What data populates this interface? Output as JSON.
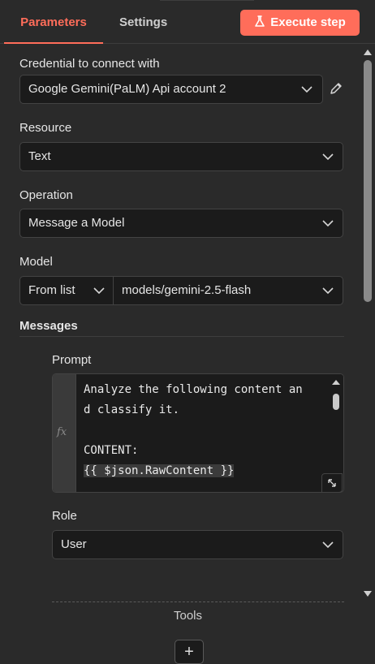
{
  "tabs": {
    "parameters": "Parameters",
    "settings": "Settings"
  },
  "execute_button": {
    "label": "Execute step",
    "color": "#ff6d5a"
  },
  "credential": {
    "label": "Credential to connect with",
    "value": "Google Gemini(PaLM) Api account 2"
  },
  "resource": {
    "label": "Resource",
    "value": "Text"
  },
  "operation": {
    "label": "Operation",
    "value": "Message a Model"
  },
  "model": {
    "label": "Model",
    "mode": "From list",
    "value": "models/gemini-2.5-flash"
  },
  "messages": {
    "label": "Messages",
    "prompt": {
      "label": "Prompt",
      "expression_icon": "fx",
      "lines": [
        "Analyze the following content an",
        "d classify it.",
        "",
        "CONTENT:",
        "{{ $json.RawContent }}"
      ]
    },
    "role": {
      "label": "Role",
      "value": "User"
    }
  },
  "tools": {
    "label": "Tools",
    "add_label": "+"
  },
  "icons": {
    "execute": "flask-icon",
    "dropdown": "chevron-down-icon",
    "edit": "pencil-icon",
    "expand": "expand-icon",
    "scroll_up": "scroll-up-arrow-icon",
    "scroll_down": "scroll-down-arrow-icon"
  }
}
